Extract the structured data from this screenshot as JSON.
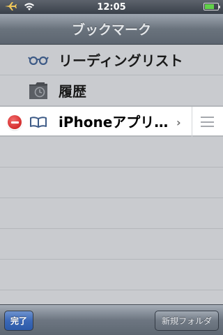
{
  "status_bar": {
    "time": "12:05",
    "left_icons": [
      "airplane-icon",
      "wifi-icon"
    ],
    "right_icons": [
      "battery-icon"
    ]
  },
  "nav": {
    "title": "ブックマーク"
  },
  "bookmarks": [
    {
      "label": "リーディングリスト",
      "icon": "glasses-icon"
    },
    {
      "label": "履歴",
      "icon": "history-clock-icon"
    },
    {
      "label": "iPhoneアプリ…",
      "icon": "book-icon"
    }
  ],
  "toolbar": {
    "done_label": "完了",
    "new_folder_label": "新規フォルダ"
  },
  "colors": {
    "accent_blue": "#3b68b7",
    "delete_red": "#c71313",
    "list_bg": "#c9cbcf",
    "bar_gray": "#6a737d"
  }
}
